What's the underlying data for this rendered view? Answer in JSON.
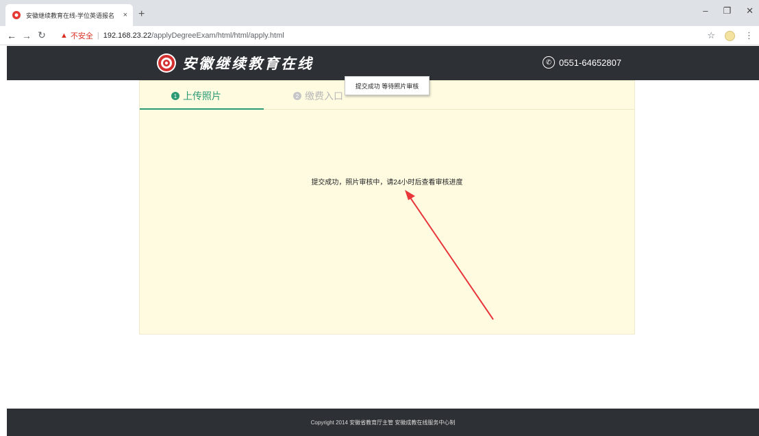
{
  "browser": {
    "tab_title": "安徽继续教育在线-学位英语报名",
    "tab_close": "×",
    "new_tab": "+",
    "security_label": "不安全",
    "url_host": "192.168.23.22",
    "url_path": "/applyDegreeExam/html/html/apply.html"
  },
  "header": {
    "logo_text": "安徽继续教育在线",
    "phone": "0551-64652807"
  },
  "steps": [
    {
      "number": "1",
      "label": "上传照片",
      "state": "active"
    },
    {
      "number": "2",
      "label": "缴费入口",
      "state": "inactive"
    }
  ],
  "tooltip": "提交成功 等待照片审核",
  "message": "提交成功，照片审核中，请24小时后查看审核进度",
  "footer": "Copyright 2014 安徽省教育厅主管 安徽成教在线服务中心制",
  "colors": {
    "header_bg": "#2d3035",
    "panel_bg": "#fefbe1",
    "accent": "#2b9a74",
    "arrow": "#e8363b"
  }
}
